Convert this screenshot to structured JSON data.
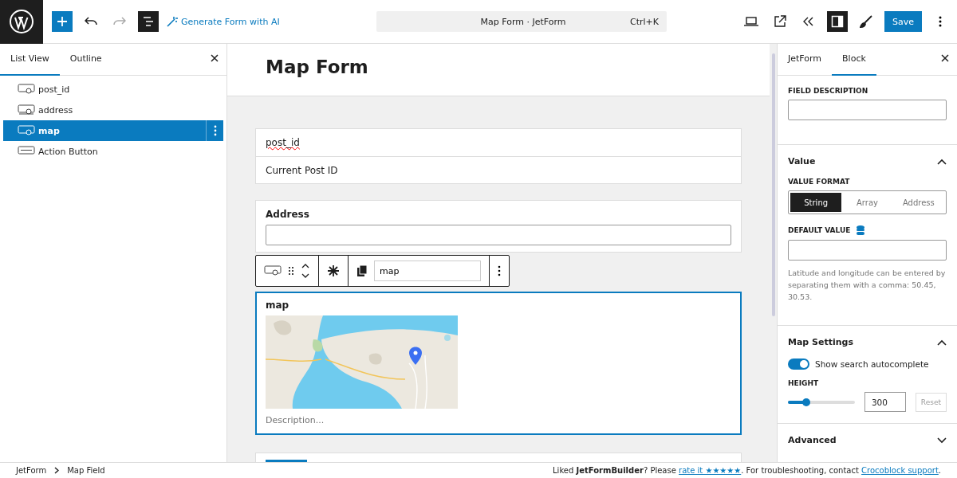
{
  "topbar": {
    "ai_button": "Generate Form with AI",
    "command": {
      "title": "Map Form · JetForm",
      "shortcut": "Ctrl+K"
    },
    "save": "Save"
  },
  "left_panel": {
    "tabs": [
      {
        "label": "List View",
        "selected": true
      },
      {
        "label": "Outline",
        "selected": false
      }
    ],
    "items": [
      {
        "label": "post_id",
        "selected": false
      },
      {
        "label": "address",
        "selected": false
      },
      {
        "label": "map",
        "selected": true
      },
      {
        "label": "Action Button",
        "selected": false
      }
    ]
  },
  "canvas": {
    "title": "Map Form",
    "hidden_field": {
      "name": "post_id",
      "value": "Current Post ID"
    },
    "address": {
      "label": "Address"
    },
    "toolbar": {
      "name_value": "map"
    },
    "map": {
      "label": "map",
      "description_placeholder": "Description..."
    }
  },
  "right_panel": {
    "tabs": [
      {
        "label": "JetForm",
        "selected": false
      },
      {
        "label": "Block",
        "selected": true
      }
    ],
    "field_description_label": "FIELD DESCRIPTION",
    "value_section": {
      "title": "Value",
      "expanded": true,
      "format_label": "VALUE FORMAT",
      "formats": [
        {
          "label": "String",
          "selected": true
        },
        {
          "label": "Array",
          "selected": false
        },
        {
          "label": "Address",
          "selected": false
        }
      ],
      "default_label": "DEFAULT VALUE",
      "help": "Latitude and longitude can be entered by separating them with a comma: 50.45, 30.53."
    },
    "map_section": {
      "title": "Map Settings",
      "expanded": true,
      "toggle": {
        "label": "Show search autocomplete",
        "on": true
      },
      "height_label": "HEIGHT",
      "height": {
        "level": 0.27,
        "value": "300"
      },
      "reset": "Reset"
    },
    "advanced_section": {
      "title": "Advanced",
      "expanded": false
    }
  },
  "status_bar": {
    "breadcrumbs": [
      "JetForm",
      "Map Field"
    ],
    "note": {
      "before": "Liked **JetFormBuilder**? Please ",
      "rate_link": "rate it ★★★★★",
      "middle": ". For troubleshooting, contact ",
      "support_link": "Crocoblock support",
      "after": "."
    }
  }
}
